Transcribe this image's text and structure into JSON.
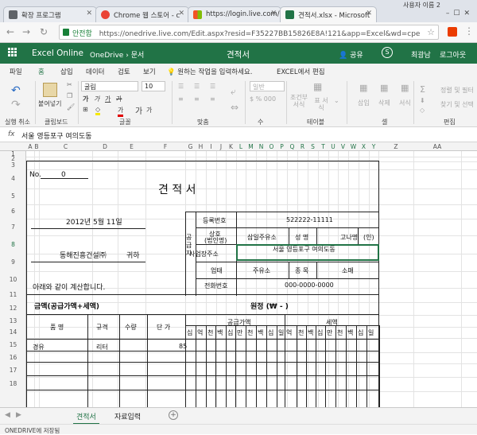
{
  "browser": {
    "tabs": [
      {
        "label": "확장 프로그램"
      },
      {
        "label": "Chrome 웹 스토어 - c"
      },
      {
        "label": "https://login.live.com/c"
      },
      {
        "label": "견적서.xlsx - Microsoft"
      }
    ],
    "user_badge": "사용자 이름 2",
    "secure_label": "안전함",
    "url": "https://onedrive.live.com/Edit.aspx?resid=F35227BB15826E8A!121&app=Excel&wd=cpe"
  },
  "app": {
    "name": "Excel Online",
    "breadcrumb_root": "OneDrive",
    "breadcrumb_sep": "›",
    "breadcrumb_folder": "문서",
    "doc_title": "견적서",
    "share_label": "공유",
    "user_name": "최광남",
    "logout_label": "로그아웃"
  },
  "ribbon": {
    "tabs": [
      "파일",
      "홈",
      "삽입",
      "데이터",
      "검토",
      "보기"
    ],
    "tell_me": "원하는 작업을 입력하세요.",
    "open_in_excel": "EXCEL에서 편집",
    "groups": [
      "실행 취소",
      "클립보드",
      "글꼴",
      "맞춤",
      "수",
      "테이블",
      "셀",
      "편집"
    ],
    "paste_label": "붙여넣기",
    "font_name": "굴림",
    "font_size": "10",
    "number_format": "일반",
    "cond_format": "조건부 서식",
    "format_table": "표 서식",
    "insert": "삽입",
    "delete": "삭제",
    "format": "서식",
    "sort_filter": "정렬 및 필터",
    "find_select": "찾기 및 선택",
    "number_buttons": "$ % 000"
  },
  "formula": {
    "fx": "fx",
    "value": "서울 영등포구 여의도동"
  },
  "grid": {
    "columns": [
      "A",
      "B",
      "C",
      "D",
      "E",
      "F",
      "G",
      "H",
      "I",
      "J",
      "K",
      "L",
      "M",
      "N",
      "O",
      "P",
      "Q",
      "R",
      "S",
      "T",
      "U",
      "V",
      "W",
      "X",
      "Y",
      "Z",
      "AA"
    ],
    "rows": [
      "1",
      "2",
      "3",
      "4",
      "5",
      "6",
      "7",
      "8",
      "9",
      "10",
      "11",
      "12",
      "13",
      "14",
      "15",
      "16",
      "17",
      "18"
    ]
  },
  "doc": {
    "no_label": "No.",
    "no_value": "0",
    "title": "견        적        서",
    "date": "2012년 5월 11일",
    "recipient": "동해진흥건설㈜",
    "honorific": "귀하",
    "supplier_label": "공급자",
    "reg_no_label": "등록번호",
    "reg_no_value": "522222-11111",
    "company_label": "상호",
    "company_label2": "(법인명)",
    "company_value": "삼일주유소",
    "name_label": "성    명",
    "name_value": "고나명",
    "seal": "(인)",
    "address_label": "사업장주소",
    "address_value": "서울 영등포구 여의도동",
    "business_label": "업태",
    "business_value": "주유소",
    "category_label": "종    목",
    "category_value": "소매",
    "phone_label": "전화번호",
    "phone_value": "000-0000-0000",
    "statement": "아래와 같이 계산합니다.",
    "total_label": "금액(공급가액+세액)",
    "total_value": "원정 (₩                    -       )",
    "item_header": "품        명",
    "spec_header": "규격",
    "qty_header": "수량",
    "price_header": "단    가",
    "supply_header": "공급가액",
    "tax_header": "세액",
    "digits_supply": [
      "십",
      "억",
      "천",
      "백",
      "십",
      "만",
      "천",
      "백",
      "십",
      "일"
    ],
    "digits_tax": [
      "억",
      "천",
      "백",
      "십",
      "만",
      "천",
      "백",
      "십",
      "일"
    ],
    "row_item": "경유",
    "row_spec": "리터",
    "row_price": "85"
  },
  "sheets": {
    "tabs": [
      "견적서",
      "자료입력"
    ]
  },
  "status": {
    "text": "ONEDRIVE에 저장됨"
  },
  "colors": {
    "excel_green": "#217346"
  }
}
